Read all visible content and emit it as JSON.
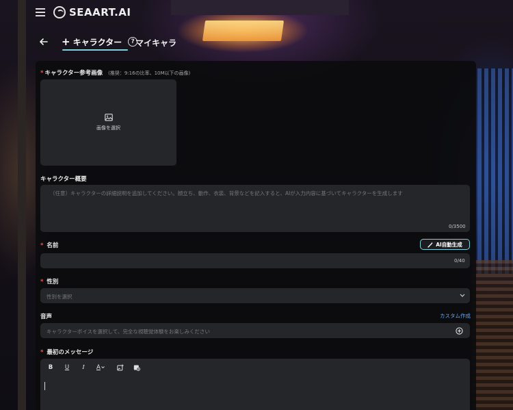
{
  "app": {
    "logo_text": "SEAART.AI"
  },
  "tabs": {
    "create_label": "キャラクター",
    "my_characters_label": "マイキャラ"
  },
  "form": {
    "reference_image": {
      "label": "キャラクター参考画像",
      "hint": "(推奨：9:16の比率、10M以下の画像)",
      "select_text": "画像を選択"
    },
    "overview": {
      "label": "キャラクター概要",
      "placeholder": "（任意）キャラクターの詳細説明を追加してください。顔立ち、動作、衣装、背景などを記入すると、AIが入力内容に基づいてキャラクターを生成します",
      "counter": "0/3500"
    },
    "name": {
      "label": "名前",
      "ai_button": "AI自動生成",
      "counter": "0/40"
    },
    "gender": {
      "label": "性別",
      "placeholder": "性別を選択"
    },
    "voice": {
      "label": "音声",
      "custom_link": "カスタム作成",
      "placeholder": "キャラクターボイスを選択して、完全な視聴覚体験をお楽しみください"
    },
    "first_message": {
      "label": "最初のメッセージ",
      "toolbar": {
        "bold": "B",
        "underline": "U",
        "italic": "I",
        "font_color": "A"
      }
    }
  },
  "colors": {
    "accent": "#7ed3df",
    "required": "#ff4d4f",
    "link": "#5ba8ff",
    "field_bg": "#25262a",
    "panel_bg": "#0c0c0e"
  },
  "icons": {
    "menu": "hamburger-icon",
    "back": "arrow-left-icon",
    "help": "question-circle-icon",
    "image": "image-icon",
    "magic": "magic-wand-icon",
    "dropdown": "chevron-down-icon",
    "add": "plus-circle-icon",
    "insert_image": "insert-image-icon",
    "insert_media": "insert-media-icon"
  }
}
